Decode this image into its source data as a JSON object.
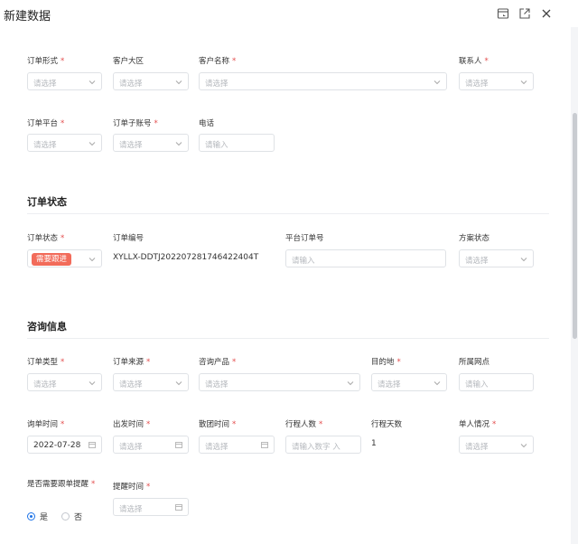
{
  "dialog": {
    "title": "新建数据"
  },
  "header_icons": [
    "window-icon",
    "external-open-icon",
    "close-icon"
  ],
  "placeholders": {
    "select": "请选择",
    "input": "请输入",
    "input_number": "请输入数字 入"
  },
  "row1": {
    "order_form": {
      "label": "订单形式",
      "required": "*"
    },
    "customer_region": {
      "label": "客户大区"
    },
    "customer_name": {
      "label": "客户名称",
      "required": "*"
    },
    "contact": {
      "label": "联系人",
      "required": "*"
    }
  },
  "row2": {
    "order_platform": {
      "label": "订单平台",
      "required": "*"
    },
    "order_sub_account": {
      "label": "订单子账号",
      "required": "*"
    },
    "phone": {
      "label": "电话"
    }
  },
  "section_status": {
    "title": "订单状态",
    "order_status": {
      "label": "订单状态",
      "required": "*",
      "tag": "需要跟进"
    },
    "order_number": {
      "label": "订单编号",
      "value": "XYLLX-DDTJ202207281746422404T"
    },
    "platform_order_no": {
      "label": "平台订单号"
    },
    "plan_status": {
      "label": "方案状态"
    }
  },
  "section_consult": {
    "title": "咨询信息",
    "order_type": {
      "label": "订单类型",
      "required": "*"
    },
    "order_source": {
      "label": "订单来源",
      "required": "*"
    },
    "consult_product": {
      "label": "咨询产品",
      "required": "*"
    },
    "destination": {
      "label": "目的地",
      "required": "*"
    },
    "outlet": {
      "label": "所属网点"
    },
    "inquiry_time": {
      "label": "询单时间",
      "required": "*",
      "value": "2022-07-28"
    },
    "departure_time": {
      "label": "出发时间",
      "required": "*"
    },
    "return_time": {
      "label": "散团时间",
      "required": "*"
    },
    "travelers": {
      "label": "行程人数",
      "required": "*"
    },
    "trip_days": {
      "label": "行程天数",
      "value": "1"
    },
    "single_status": {
      "label": "单人情况",
      "required": "*"
    },
    "need_reminder": {
      "label": "是否需要跟单提醒",
      "required": "*",
      "yes": "是",
      "no": "否"
    },
    "reminder_time": {
      "label": "提醒时间",
      "required": "*"
    }
  },
  "colors": {
    "required": "#e34d4d",
    "tag": "#f26b5a",
    "radio_on": "#1d73e8"
  }
}
